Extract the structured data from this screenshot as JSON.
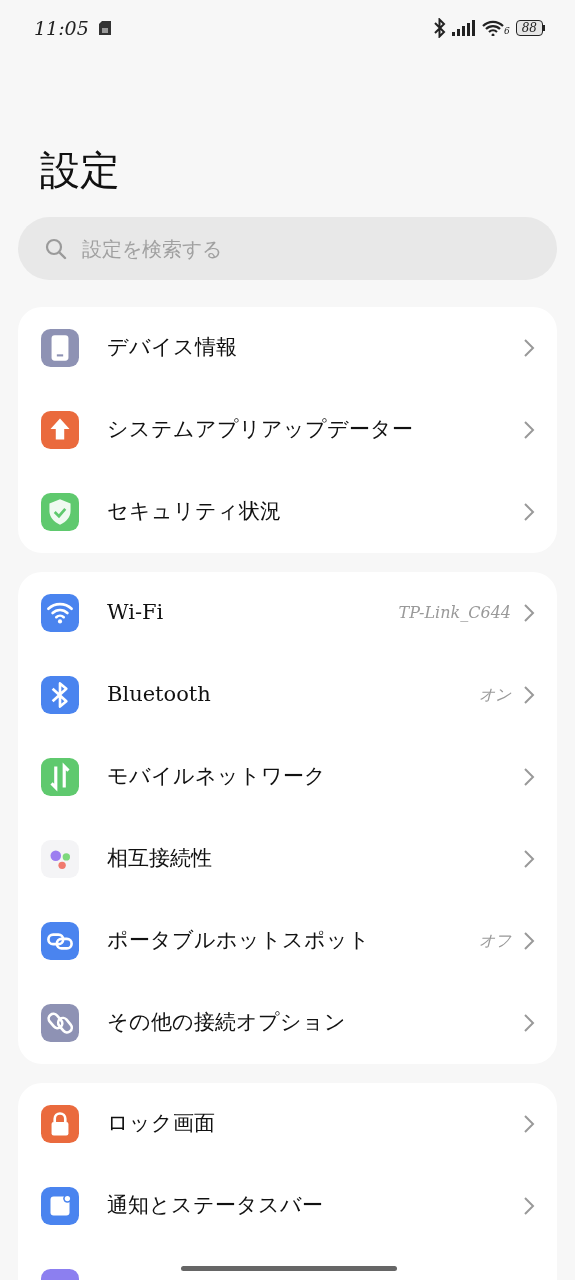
{
  "status_bar": {
    "time": "11:05",
    "wifi_band": "6",
    "battery": "88"
  },
  "title": "設定",
  "search": {
    "placeholder": "設定を検索する"
  },
  "groups": [
    {
      "items": [
        {
          "kind": "device",
          "label": "デバイス情報"
        },
        {
          "kind": "update",
          "label": "システムアプリアップデーター"
        },
        {
          "kind": "shield",
          "label": "セキュリティ状況"
        }
      ]
    },
    {
      "items": [
        {
          "kind": "wifi",
          "label": "Wi-Fi",
          "value": "TP-Link_C644"
        },
        {
          "kind": "bluetooth",
          "label": "Bluetooth",
          "value": "オン"
        },
        {
          "kind": "mobile",
          "label": "モバイルネットワーク"
        },
        {
          "kind": "connect",
          "label": "相互接続性"
        },
        {
          "kind": "hotspot",
          "label": "ポータブルホットスポット",
          "value": "オフ"
        },
        {
          "kind": "link",
          "label": "その他の接続オプション"
        }
      ]
    },
    {
      "items": [
        {
          "kind": "lock",
          "label": "ロック画面"
        },
        {
          "kind": "notification",
          "label": "通知とステータスバー"
        },
        {
          "kind": "display"
        }
      ]
    }
  ]
}
